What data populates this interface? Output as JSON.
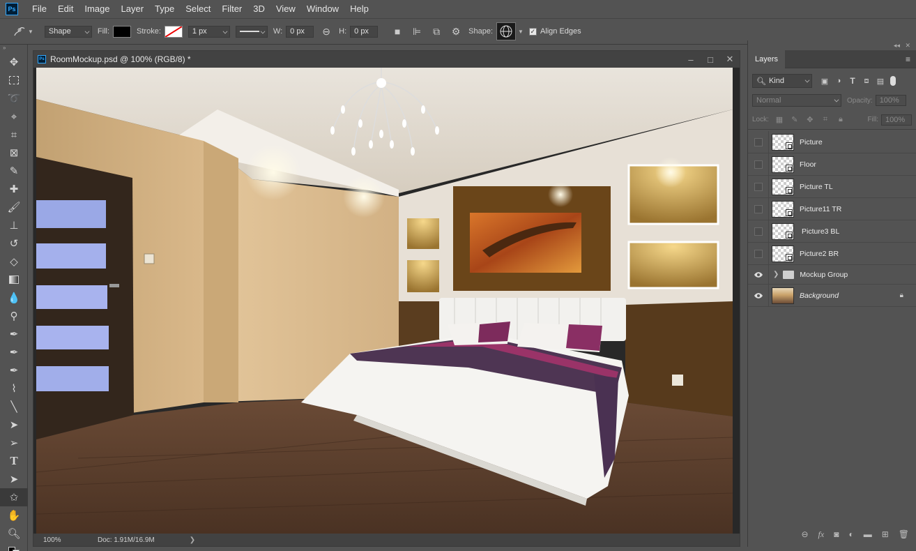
{
  "app": {
    "logo": "Ps"
  },
  "menu": [
    "File",
    "Edit",
    "Image",
    "Layer",
    "Type",
    "Select",
    "Filter",
    "3D",
    "View",
    "Window",
    "Help"
  ],
  "options": {
    "mode": "Shape",
    "fill_label": "Fill:",
    "stroke_label": "Stroke:",
    "stroke_width": "1 px",
    "w_label": "W:",
    "w_value": "0 px",
    "h_label": "H:",
    "h_value": "0 px",
    "shape_label": "Shape:",
    "align_edges": "Align Edges"
  },
  "document": {
    "title": "RoomMockup.psd @ 100% (RGB/8) *",
    "zoom": "100%",
    "doc_info": "Doc: 1.91M/16.9M"
  },
  "layers_panel": {
    "tab": "Layers",
    "filter": "Kind",
    "blend_mode": "Normal",
    "opacity_label": "Opacity:",
    "opacity_value": "100%",
    "lock_label": "Lock:",
    "fill_label": "Fill:",
    "fill_value": "100%",
    "layers": [
      {
        "name": "Picture",
        "visible": false
      },
      {
        "name": "Floor",
        "visible": false
      },
      {
        "name": "Picture TL",
        "visible": false
      },
      {
        "name": "Picture11 TR",
        "visible": false
      },
      {
        "name": "Picture3 BL",
        "visible": false
      },
      {
        "name": "Picture2 BR",
        "visible": false
      },
      {
        "name": "Mockup Group",
        "visible": true
      },
      {
        "name": "Background",
        "visible": true
      }
    ]
  },
  "colors": {
    "accent": "#31a8ff",
    "panel": "#535353",
    "dark": "#424242"
  }
}
